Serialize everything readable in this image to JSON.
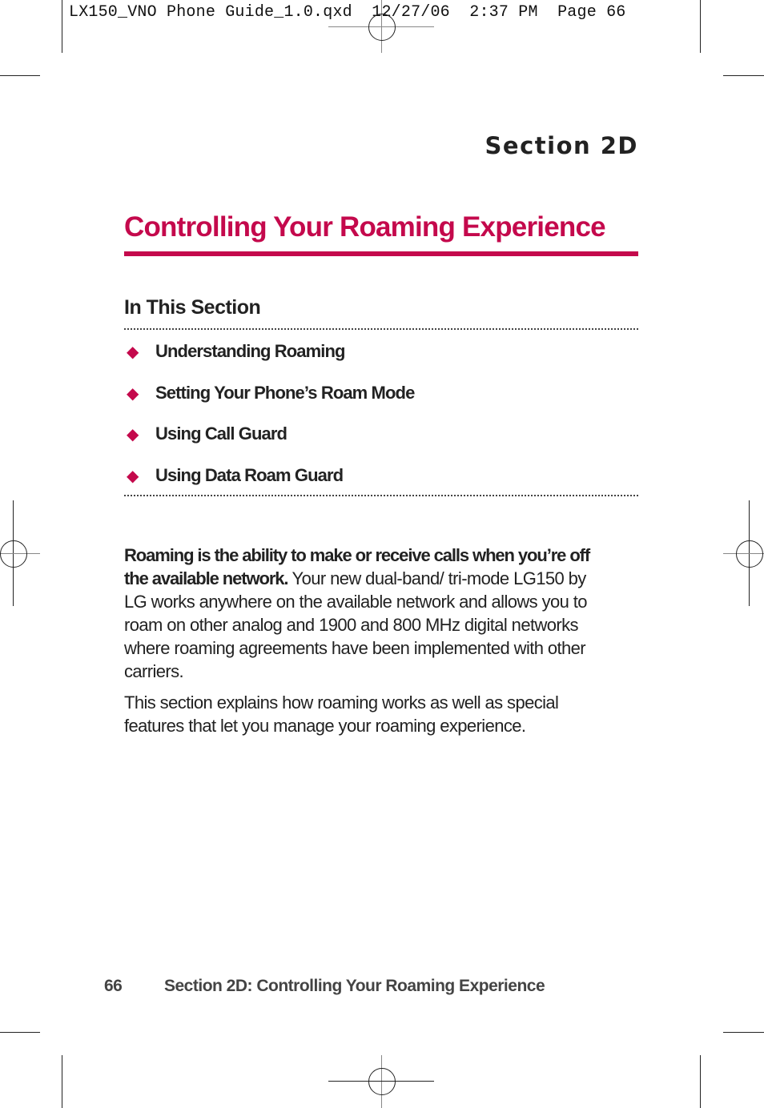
{
  "slug_line": "LX150_VNO Phone Guide_1.0.qxd  12/27/06  2:37 PM  Page 66",
  "section_label": "Section 2D",
  "chapter_title": "Controlling Your Roaming Experience",
  "in_this_section": {
    "heading": "In This Section",
    "bullet_icon": "diamond",
    "items": [
      {
        "label": "Understanding Roaming"
      },
      {
        "label": "Setting Your Phone’s Roam Mode"
      },
      {
        "label": "Using Call Guard"
      },
      {
        "label": "Using Data Roam Guard"
      }
    ]
  },
  "body": {
    "para1_bold": "Roaming is the ability to make or receive calls when you’re off the available network.",
    "para1_rest": " Your new dual-band/ tri-mode LG150 by LG works anywhere on the available network and allows you to roam on other analog and 1900 and 800 MHz digital networks where roaming agreements have been implemented with other carriers.",
    "para2": "This section explains how roaming works as well as special features that let you manage your roaming experience."
  },
  "footer": {
    "page_number": "66",
    "running_title": "Section 2D: Controlling Your Roaming Experience"
  },
  "colors": {
    "accent": "#c4094c",
    "text": "#222222"
  }
}
